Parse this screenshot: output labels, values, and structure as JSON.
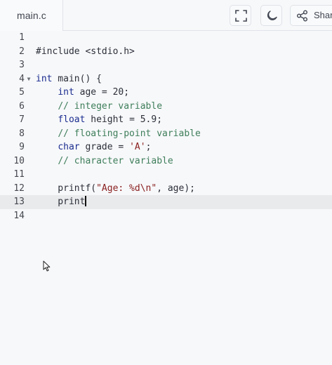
{
  "tab": {
    "filename": "main.c"
  },
  "toolbar": {
    "fullscreen_icon": "fullscreen-icon",
    "theme_icon": "moon-icon",
    "share_icon": "share-icon",
    "share_label": "Share"
  },
  "editor": {
    "active_line": 13,
    "lines": [
      {
        "number": "1",
        "fold": "",
        "tokens": []
      },
      {
        "number": "2",
        "fold": "",
        "tokens": [
          {
            "t": "#include <stdio.h>",
            "c": "c-pp"
          }
        ]
      },
      {
        "number": "3",
        "fold": "",
        "tokens": []
      },
      {
        "number": "4",
        "fold": "▼",
        "tokens": [
          {
            "t": "int",
            "c": "c-kw"
          },
          {
            "t": " main() {",
            "c": ""
          }
        ]
      },
      {
        "number": "5",
        "fold": "",
        "tokens": [
          {
            "t": "    ",
            "c": ""
          },
          {
            "t": "int",
            "c": "c-kw"
          },
          {
            "t": " age = 20;",
            "c": ""
          }
        ]
      },
      {
        "number": "6",
        "fold": "",
        "tokens": [
          {
            "t": "    ",
            "c": ""
          },
          {
            "t": "// integer variable",
            "c": "c-cm"
          }
        ]
      },
      {
        "number": "7",
        "fold": "",
        "tokens": [
          {
            "t": "    ",
            "c": ""
          },
          {
            "t": "float",
            "c": "c-kw"
          },
          {
            "t": " height = 5.9;",
            "c": ""
          }
        ]
      },
      {
        "number": "8",
        "fold": "",
        "tokens": [
          {
            "t": "    ",
            "c": ""
          },
          {
            "t": "// floating-point variable",
            "c": "c-cm"
          }
        ]
      },
      {
        "number": "9",
        "fold": "",
        "tokens": [
          {
            "t": "    ",
            "c": ""
          },
          {
            "t": "char",
            "c": "c-kw"
          },
          {
            "t": " grade = ",
            "c": ""
          },
          {
            "t": "'A'",
            "c": "c-str"
          },
          {
            "t": ";",
            "c": ""
          }
        ]
      },
      {
        "number": "10",
        "fold": "",
        "tokens": [
          {
            "t": "    ",
            "c": ""
          },
          {
            "t": "// character variable",
            "c": "c-cm"
          }
        ]
      },
      {
        "number": "11",
        "fold": "",
        "tokens": []
      },
      {
        "number": "12",
        "fold": "",
        "tokens": [
          {
            "t": "    printf(",
            "c": ""
          },
          {
            "t": "\"Age: %d\\n\"",
            "c": "c-str"
          },
          {
            "t": ", age);",
            "c": ""
          }
        ]
      },
      {
        "number": "13",
        "fold": "",
        "caret": true,
        "tokens": [
          {
            "t": "    print",
            "c": ""
          }
        ]
      },
      {
        "number": "14",
        "fold": "",
        "tokens": []
      }
    ]
  }
}
